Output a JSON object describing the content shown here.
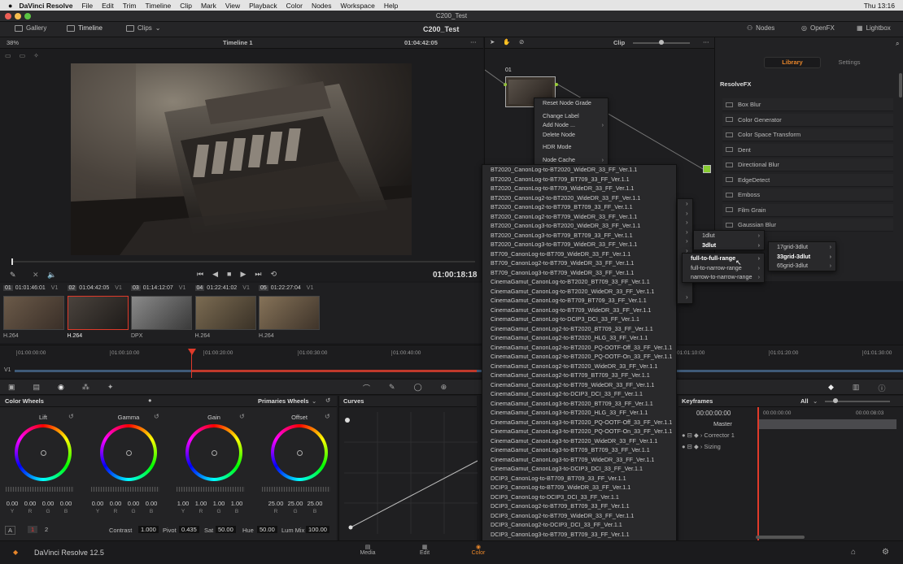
{
  "macbar": {
    "app": "DaVinci Resolve",
    "menus": [
      "File",
      "Edit",
      "Trim",
      "Timeline",
      "Clip",
      "Mark",
      "View",
      "Playback",
      "Color",
      "Nodes",
      "Workspace",
      "Help"
    ],
    "clock": "Thu 13:16"
  },
  "window_title": "C200_Test",
  "topbar": {
    "gallery": "Gallery",
    "timeline": "Timeline",
    "clips": "Clips",
    "project": "C200_Test",
    "nodes": "Nodes",
    "openfx": "OpenFX",
    "lightbox": "Lightbox"
  },
  "viewer": {
    "zoom": "38%",
    "timeline_name": "Timeline 1",
    "timecode": "01:04:42:05",
    "clip_label": "Clip",
    "transport_time": "01:00:18:18"
  },
  "clips": [
    {
      "num": "01",
      "tc": "01:01:46:01",
      "track": "V1",
      "codec": "H.264"
    },
    {
      "num": "02",
      "tc": "01:04:42:05",
      "track": "V1",
      "codec": "H.264"
    },
    {
      "num": "03",
      "tc": "01:14:12:07",
      "track": "V1",
      "codec": "DPX"
    },
    {
      "num": "04",
      "tc": "01:22:41:02",
      "track": "V1",
      "codec": "H.264"
    },
    {
      "num": "05",
      "tc": "01:22:27:04",
      "track": "V1",
      "codec": "H.264"
    }
  ],
  "timeline": {
    "ticks": [
      "01:00:00:00",
      "01:00:10:00",
      "01:00:20:00",
      "01:00:30:00",
      "01:00:40:00",
      "01:01:10:00",
      "01:01:20:00",
      "01:01:30:00"
    ],
    "track": "V1"
  },
  "node": {
    "label": "01"
  },
  "node_menu": [
    "Reset Node Grade",
    "Change Label",
    "Add Node ...",
    "Delete Node",
    "HDR Mode",
    "Node Cache"
  ],
  "lut_menu": [
    "BT2020_CanonLog-to-BT2020_WideDR_33_FF_Ver.1.1",
    "BT2020_CanonLog-to-BT709_BT709_33_FF_Ver.1.1",
    "BT2020_CanonLog-to-BT709_WideDR_33_FF_Ver.1.1",
    "BT2020_CanonLog2-to-BT2020_WideDR_33_FF_Ver.1.1",
    "BT2020_CanonLog2-to-BT709_BT709_33_FF_Ver.1.1",
    "BT2020_CanonLog2-to-BT709_WideDR_33_FF_Ver.1.1",
    "BT2020_CanonLog3-to-BT2020_WideDR_33_FF_Ver.1.1",
    "BT2020_CanonLog3-to-BT709_BT709_33_FF_Ver.1.1",
    "BT2020_CanonLog3-to-BT709_WideDR_33_FF_Ver.1.1",
    "BT709_CanonLog-to-BT709_WideDR_33_FF_Ver.1.1",
    "BT709_CanonLog2-to-BT709_WideDR_33_FF_Ver.1.1",
    "BT709_CanonLog3-to-BT709_WideDR_33_FF_Ver.1.1",
    "CinemaGamut_CanonLog-to-BT2020_BT709_33_FF_Ver.1.1",
    "CinemaGamut_CanonLog-to-BT2020_WideDR_33_FF_Ver.1.1",
    "CinemaGamut_CanonLog-to-BT709_BT709_33_FF_Ver.1.1",
    "CinemaGamut_CanonLog-to-BT709_WideDR_33_FF_Ver.1.1",
    "CinemaGamut_CanonLog-to-DCIP3_DCI_33_FF_Ver.1.1",
    "CinemaGamut_CanonLog2-to-BT2020_BT709_33_FF_Ver.1.1",
    "CinemaGamut_CanonLog2-to-BT2020_HLG_33_FF_Ver.1.1",
    "CinemaGamut_CanonLog2-to-BT2020_PQ-OOTF-Off_33_FF_Ver.1.1",
    "CinemaGamut_CanonLog2-to-BT2020_PQ-OOTF-On_33_FF_Ver.1.1",
    "CinemaGamut_CanonLog2-to-BT2020_WideDR_33_FF_Ver.1.1",
    "CinemaGamut_CanonLog2-to-BT709_BT709_33_FF_Ver.1.1",
    "CinemaGamut_CanonLog2-to-BT709_WideDR_33_FF_Ver.1.1",
    "CinemaGamut_CanonLog2-to-DCIP3_DCI_33_FF_Ver.1.1",
    "CinemaGamut_CanonLog3-to-BT2020_BT709_33_FF_Ver.1.1",
    "CinemaGamut_CanonLog3-to-BT2020_HLG_33_FF_Ver.1.1",
    "CinemaGamut_CanonLog3-to-BT2020_PQ-OOTF-Off_33_FF_Ver.1.1",
    "CinemaGamut_CanonLog3-to-BT2020_PQ-OOTF-On_33_FF_Ver.1.1",
    "CinemaGamut_CanonLog3-to-BT2020_WideDR_33_FF_Ver.1.1",
    "CinemaGamut_CanonLog3-to-BT709_BT709_33_FF_Ver.1.1",
    "CinemaGamut_CanonLog3-to-BT709_WideDR_33_FF_Ver.1.1",
    "CinemaGamut_CanonLog3-to-DCIP3_DCI_33_FF_Ver.1.1",
    "DCIP3_CanonLog-to-BT709_BT709_33_FF_Ver.1.1",
    "DCIP3_CanonLog-to-BT709_WideDR_33_FF_Ver.1.1",
    "DCIP3_CanonLog-to-DCIP3_DCI_33_FF_Ver.1.1",
    "DCIP3_CanonLog2-to-BT709_BT709_33_FF_Ver.1.1",
    "DCIP3_CanonLog2-to-BT709_WideDR_33_FF_Ver.1.1",
    "DCIP3_CanonLog2-to-DCIP3_DCI_33_FF_Ver.1.1",
    "DCIP3_CanonLog3-to-BT709_BT709_33_FF_Ver.1.1",
    "DCIP3_CanonLog3-to-BT709_WideDR_33_FF_Ver.1.1",
    "DCIP3_CanonLog3-to-DCIP3_DCI_33_FF_Ver.1.1"
  ],
  "lut_sub1": [
    "1dlut",
    "3dlut"
  ],
  "lut_sub2": [
    "full-to-full-range",
    "full-to-narrow-range",
    "narrow-to-narrow-range"
  ],
  "lut_sub3": [
    "17grid-3dlut",
    "33grid-3dlut",
    "65grid-3dlut"
  ],
  "fx": {
    "tab_library": "Library",
    "tab_settings": "Settings",
    "section": "ResolveFX",
    "items": [
      "Box Blur",
      "Color Generator",
      "Color Space Transform",
      "Dent",
      "Directional Blur",
      "EdgeDetect",
      "Emboss",
      "Film Grain",
      "Gaussian Blur"
    ]
  },
  "wheels": {
    "title": "Color Wheels",
    "mode": "Primaries Wheels",
    "items": [
      {
        "name": "Lift",
        "vals": [
          "0.00",
          "0.00",
          "0.00",
          "0.00"
        ],
        "labs": [
          "Y",
          "R",
          "G",
          "B"
        ]
      },
      {
        "name": "Gamma",
        "vals": [
          "0.00",
          "0.00",
          "0.00",
          "0.00"
        ],
        "labs": [
          "Y",
          "R",
          "G",
          "B"
        ]
      },
      {
        "name": "Gain",
        "vals": [
          "1.00",
          "1.00",
          "1.00",
          "1.00"
        ],
        "labs": [
          "Y",
          "R",
          "G",
          "B"
        ]
      },
      {
        "name": "Offset",
        "vals": [
          "25.00",
          "25.00",
          "25.00"
        ],
        "labs": [
          "R",
          "G",
          "B"
        ]
      }
    ],
    "bottom": {
      "a": "A",
      "p1": "1",
      "p2": "2",
      "contrast_l": "Contrast",
      "contrast": "1.000",
      "pivot_l": "Pivot",
      "pivot": "0.435",
      "sat_l": "Sat",
      "sat": "50.00",
      "hue_l": "Hue",
      "hue": "50.00",
      "lum_l": "Lum Mix",
      "lum": "100.00"
    }
  },
  "curves": {
    "title": "Curves"
  },
  "keyframes": {
    "title": "Keyframes",
    "filter": "All",
    "tc": "00:00:00:00",
    "tc0": "00:00:00:00",
    "tc1": "00:00:08:03",
    "rows": [
      "Master",
      "Corrector 1",
      "Sizing"
    ]
  },
  "footer": {
    "brand": "DaVinci Resolve 12.5",
    "media": "Media",
    "edit": "Edit",
    "color": "Color"
  }
}
